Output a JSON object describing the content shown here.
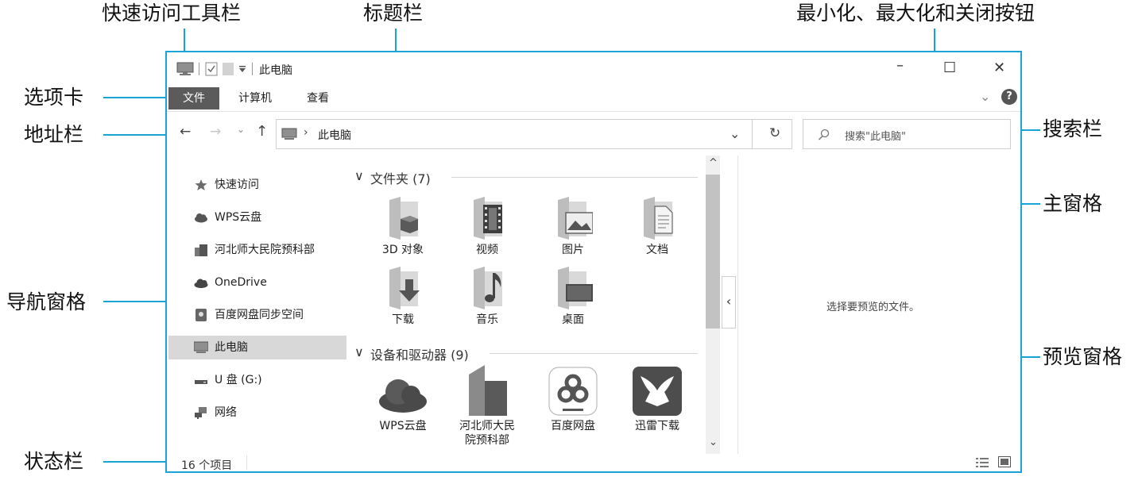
{
  "callouts": {
    "quick_access_toolbar": "快速访问工具栏",
    "title_bar": "标题栏",
    "window_controls": "最小化、最大化和关闭按钮",
    "ribbon_tabs": "选项卡",
    "address_bar": "地址栏",
    "search_bar": "搜索栏",
    "main_pane": "主窗格",
    "nav_pane": "导航窗格",
    "preview_pane": "预览窗格",
    "status_bar": "状态栏"
  },
  "window": {
    "title": "此电脑",
    "minimize": "–",
    "maximize": "☐",
    "close": "✕"
  },
  "tabs": [
    {
      "label": "文件",
      "active": true
    },
    {
      "label": "计算机",
      "active": false
    },
    {
      "label": "查看",
      "active": false
    }
  ],
  "address": {
    "crumb": "此电脑",
    "separator": "›",
    "back": "←",
    "forward": "→",
    "recent": "⌄",
    "up": "↑",
    "dropdown": "⌄",
    "refresh": "↻"
  },
  "search": {
    "placeholder": "搜索\"此电脑\""
  },
  "help": "?",
  "ribbon_collapse": "⌄",
  "nav": [
    {
      "label": "快速访问",
      "icon": "star-icon"
    },
    {
      "label": "WPS云盘",
      "icon": "cloud-icon"
    },
    {
      "label": "河北师大民院预科部",
      "icon": "building-icon"
    },
    {
      "label": "OneDrive",
      "icon": "onedrive-cloud-icon"
    },
    {
      "label": "百度网盘同步空间",
      "icon": "baidu-sync-icon"
    },
    {
      "label": "此电脑",
      "icon": "computer-icon",
      "selected": true
    },
    {
      "label": "U 盘 (G:)",
      "icon": "usb-drive-icon"
    },
    {
      "label": "网络",
      "icon": "network-icon"
    }
  ],
  "groups": {
    "folders": {
      "collapse": "∨",
      "title": "文件夹 (7)"
    },
    "devices": {
      "collapse": "∨",
      "title": "设备和驱动器 (9)"
    }
  },
  "folders": [
    {
      "label": "3D 对象",
      "icon": "3d-objects-folder-icon"
    },
    {
      "label": "视频",
      "icon": "videos-folder-icon"
    },
    {
      "label": "图片",
      "icon": "pictures-folder-icon"
    },
    {
      "label": "文档",
      "icon": "documents-folder-icon"
    },
    {
      "label": "下载",
      "icon": "downloads-folder-icon"
    },
    {
      "label": "音乐",
      "icon": "music-folder-icon"
    },
    {
      "label": "桌面",
      "icon": "desktop-folder-icon"
    }
  ],
  "devices": [
    {
      "label": "WPS云盘",
      "icon": "wps-cloud-icon"
    },
    {
      "label": "河北师大民\n院预科部",
      "icon": "building-drive-icon"
    },
    {
      "label": "百度网盘",
      "icon": "baidu-netdisk-icon"
    },
    {
      "label": "迅雷下载",
      "icon": "xunlei-icon"
    }
  ],
  "preview": {
    "empty_text": "选择要预览的文件。",
    "toggle": "‹"
  },
  "scrollbar": {
    "up": "^",
    "down": "⌄"
  },
  "status": {
    "items": "16 个项目"
  }
}
